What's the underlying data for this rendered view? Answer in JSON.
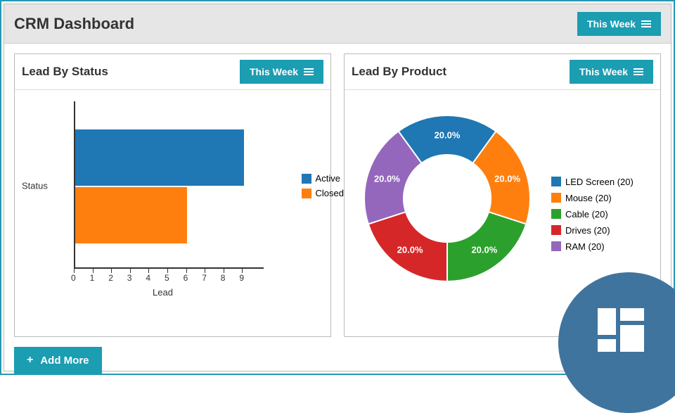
{
  "header": {
    "title": "CRM Dashboard",
    "filter_label": "This Week"
  },
  "panel_status": {
    "title": "Lead By Status",
    "filter_label": "This Week"
  },
  "panel_product": {
    "title": "Lead By Product",
    "filter_label": "This Week"
  },
  "buttons": {
    "add_more": "Add More"
  },
  "colors": {
    "teal": "#1b9db2",
    "blue": "#1f77b4",
    "orange": "#ff7f0e",
    "green": "#2ca02c",
    "red": "#d62728",
    "purple": "#9467bd",
    "fab": "#3f749e"
  },
  "chart_data": [
    {
      "id": "lead_by_status",
      "type": "bar",
      "orientation": "horizontal",
      "title": "Lead By Status",
      "xlabel": "Lead",
      "ylabel": "Status",
      "xlim": [
        0,
        9
      ],
      "x_ticks": [
        0,
        1,
        2,
        3,
        4,
        5,
        6,
        7,
        8,
        9
      ],
      "series": [
        {
          "name": "Active",
          "value": 9,
          "color": "#1f77b4"
        },
        {
          "name": "Closed",
          "value": 6,
          "color": "#ff7f0e"
        }
      ],
      "legend": [
        "Active",
        "Closed"
      ]
    },
    {
      "id": "lead_by_product",
      "type": "donut",
      "title": "Lead By Product",
      "series": [
        {
          "name": "LED Screen",
          "count": 20,
          "percent": 20.0,
          "color": "#1f77b4"
        },
        {
          "name": "Mouse",
          "count": 20,
          "percent": 20.0,
          "color": "#ff7f0e"
        },
        {
          "name": "Cable",
          "count": 20,
          "percent": 20.0,
          "color": "#2ca02c"
        },
        {
          "name": "Drives",
          "count": 20,
          "percent": 20.0,
          "color": "#d62728"
        },
        {
          "name": "RAM",
          "count": 20,
          "percent": 20.0,
          "color": "#9467bd"
        }
      ],
      "legend_labels": [
        "LED Screen (20)",
        "Mouse (20)",
        "Cable (20)",
        "Drives (20)",
        "RAM (20)"
      ],
      "slice_labels": [
        "20.0%",
        "20.0%",
        "20.0%",
        "20.0%",
        "20.0%"
      ]
    }
  ]
}
